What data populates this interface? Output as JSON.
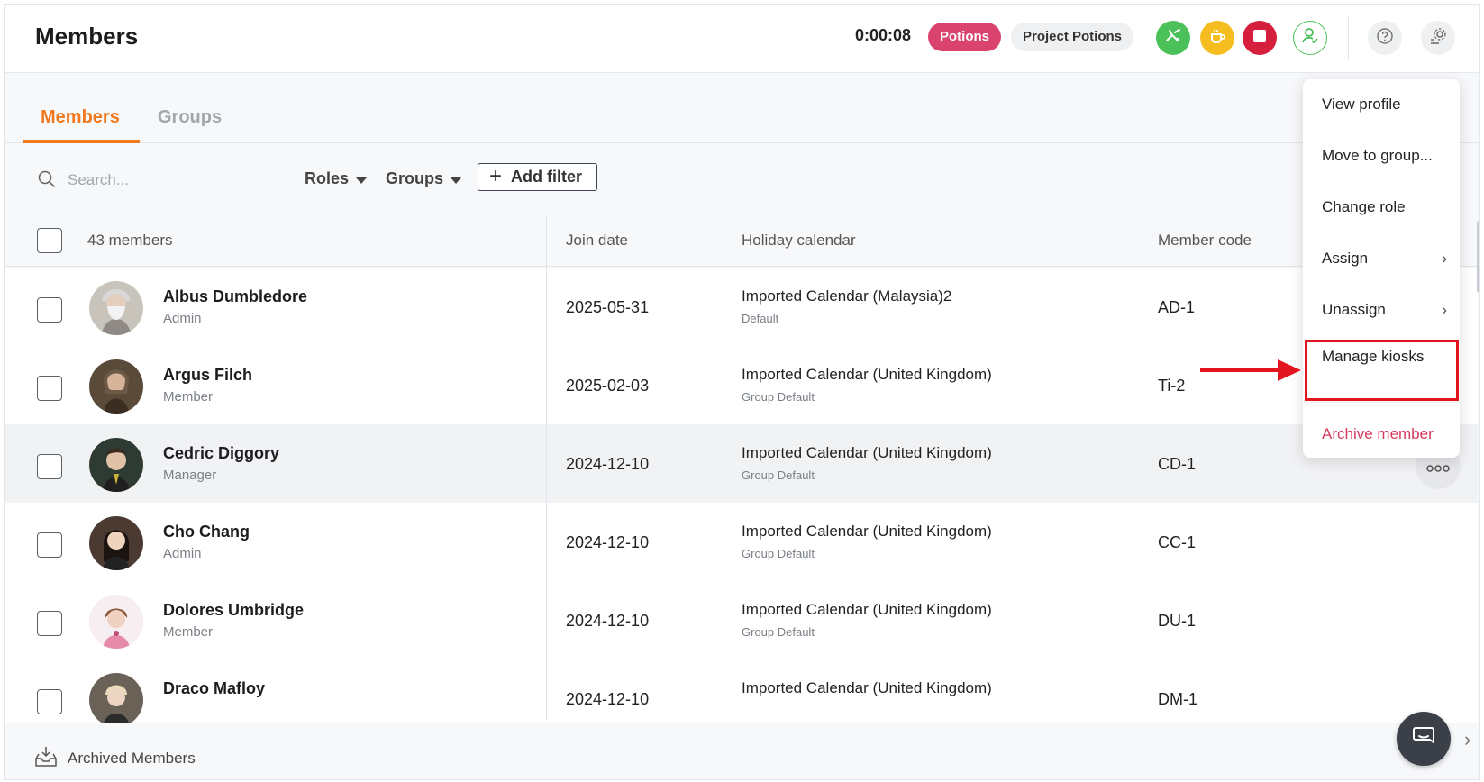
{
  "header": {
    "title": "Members",
    "timer": "0:00:08",
    "project_tag": "Potions",
    "project_name": "Project Potions",
    "icons": [
      "switch-task-icon",
      "break-cup-icon",
      "stop-icon",
      "user-check-icon",
      "help-icon",
      "settings-icon"
    ],
    "colors": {
      "green": "#4cc15a",
      "yellow": "#f5bd1f",
      "red": "#d61f3c",
      "tag": "#d9436d"
    }
  },
  "tabs": [
    {
      "label": "Members",
      "active": true
    },
    {
      "label": "Groups",
      "active": false
    }
  ],
  "toolbar": {
    "search_placeholder": "Search...",
    "roles_label": "Roles",
    "groups_label": "Groups",
    "add_filter_label": "Add filter"
  },
  "table": {
    "member_count": "43 members",
    "columns": [
      "Join date",
      "Holiday calendar",
      "Member code"
    ],
    "rows": [
      {
        "name": "Albus Dumbledore",
        "role": "Admin",
        "join_date": "2025-05-31",
        "calendar": "Imported Calendar (Malaysia)2",
        "calendar_sub": "Default",
        "code": "AD-1"
      },
      {
        "name": "Argus Filch",
        "role": "Member",
        "join_date": "2025-02-03",
        "calendar": "Imported Calendar (United Kingdom)",
        "calendar_sub": "Group Default",
        "code": "Ti-2"
      },
      {
        "name": "Cedric Diggory",
        "role": "Manager",
        "join_date": "2024-12-10",
        "calendar": "Imported Calendar (United Kingdom)",
        "calendar_sub": "Group Default",
        "code": "CD-1"
      },
      {
        "name": "Cho Chang",
        "role": "Admin",
        "join_date": "2024-12-10",
        "calendar": "Imported Calendar (United Kingdom)",
        "calendar_sub": "Group Default",
        "code": "CC-1"
      },
      {
        "name": "Dolores Umbridge",
        "role": "Member",
        "join_date": "2024-12-10",
        "calendar": "Imported Calendar (United Kingdom)",
        "calendar_sub": "Group Default",
        "code": "DU-1"
      },
      {
        "name": "Draco Mafloy",
        "role": "",
        "join_date": "2024-12-10",
        "calendar": "Imported Calendar (United Kingdom)",
        "calendar_sub": "",
        "code": "DM-1"
      }
    ]
  },
  "menu": {
    "items": [
      {
        "label": "View profile",
        "submenu": false
      },
      {
        "label": "Move to group...",
        "submenu": false
      },
      {
        "label": "Change role",
        "submenu": false
      },
      {
        "label": "Assign",
        "submenu": true
      },
      {
        "label": "Unassign",
        "submenu": true
      },
      {
        "label": "Manage kiosks",
        "submenu": false,
        "highlighted": true
      },
      {
        "label": "Archive member",
        "submenu": false,
        "danger": true
      }
    ],
    "highlight_color": "#e2141e",
    "more_icon": "more-horizontal-icon"
  },
  "footer": {
    "archived_label": "Archived Members",
    "chat_icon": "chat-bubble-icon"
  }
}
